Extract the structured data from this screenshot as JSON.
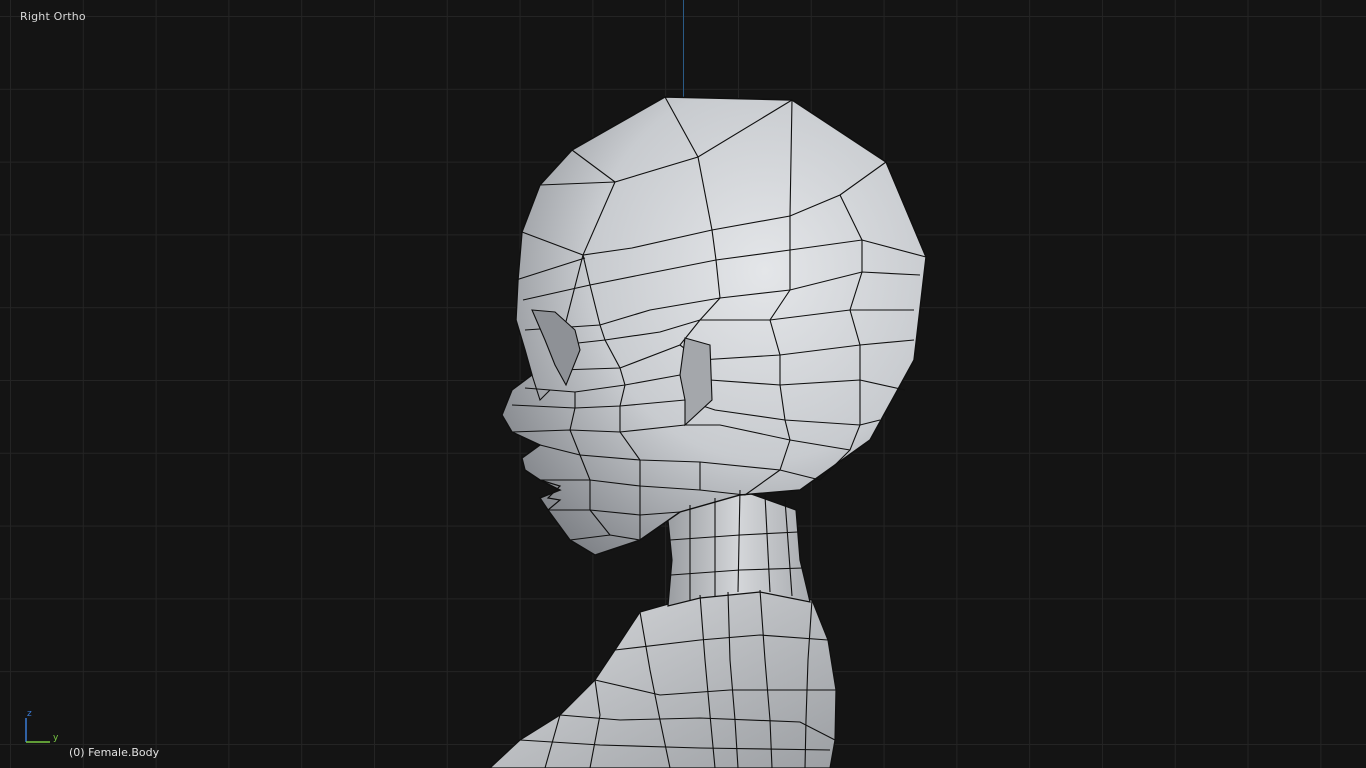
{
  "viewport": {
    "view_name": "Right Ortho",
    "active_object": "(0) Female.Body"
  },
  "axis_gizmo": {
    "z_label": "z",
    "y_label": "y",
    "z_color": "#3a7bd5",
    "y_color": "#7ac943"
  },
  "colors": {
    "background": "#141414",
    "grid": "#242424",
    "mesh_fill": "#c9ccd0",
    "wire": "#101010"
  }
}
